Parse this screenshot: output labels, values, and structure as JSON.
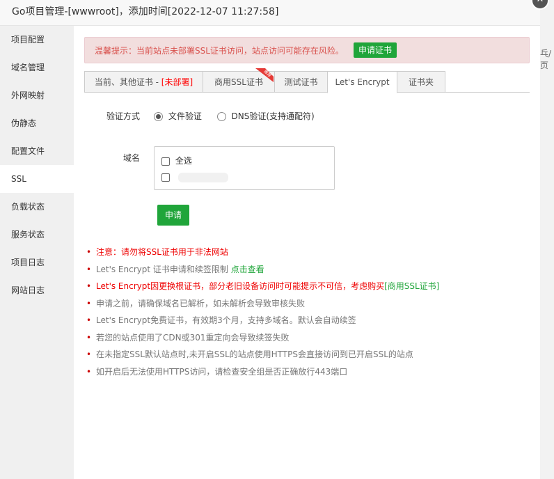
{
  "dialog": {
    "title": "Go项目管理-[wwwroot]，添加时间[2022-12-07 11:27:58]",
    "close_glyph": "✕",
    "right_fragment": "乓/页"
  },
  "sidebar": {
    "items": [
      {
        "label": "项目配置"
      },
      {
        "label": "域名管理"
      },
      {
        "label": "外网映射"
      },
      {
        "label": "伪静态"
      },
      {
        "label": "配置文件"
      },
      {
        "label": "SSL"
      },
      {
        "label": "负载状态"
      },
      {
        "label": "服务状态"
      },
      {
        "label": "项目日志"
      },
      {
        "label": "网站日志"
      }
    ],
    "active_index": 5
  },
  "alert": {
    "text": "温馨提示：当前站点未部署SSL证书访问，站点访问可能存在风险。",
    "button": "申请证书"
  },
  "tabs": {
    "items": [
      {
        "label": "当前、其他证书 - ",
        "extra": "[未部署]"
      },
      {
        "label": "商用SSL证书",
        "badge": "推荐"
      },
      {
        "label": "测试证书"
      },
      {
        "label": "Let's Encrypt"
      },
      {
        "label": "证书夹"
      }
    ],
    "active_index": 3
  },
  "form": {
    "verify_label": "验证方式",
    "verify_options": [
      {
        "label": "文件验证",
        "checked": true
      },
      {
        "label": "DNS验证(支持通配符)",
        "checked": false
      }
    ],
    "domain_label": "域名",
    "select_all_label": "全选",
    "submit_button": "申请"
  },
  "notes": [
    {
      "text": "注意：请勿将SSL证书用于非法网站",
      "style": "red"
    },
    {
      "text": "Let's Encrypt 证书申请和续签限制 ",
      "link": "点击查看",
      "style": "gray"
    },
    {
      "text": "Let's Encrypt因更换根证书，部分老旧设备访问时可能提示不可信，考虑购买",
      "link": "[商用SSL证书]",
      "style": "red"
    },
    {
      "text": "申请之前，请确保域名已解析，如未解析会导致审核失败",
      "style": "gray"
    },
    {
      "text": "Let's Encrypt免费证书，有效期3个月，支持多域名。默认会自动续签",
      "style": "gray"
    },
    {
      "text": "若您的站点使用了CDN或301重定向会导致续签失败",
      "style": "gray"
    },
    {
      "text": "在未指定SSL默认站点时,未开启SSL的站点使用HTTPS会直接访问到已开启SSL的站点",
      "style": "gray"
    },
    {
      "text": "如开启后无法使用HTTPS访问，请检查安全组是否正确放行443端口",
      "style": "gray"
    }
  ],
  "colors": {
    "accent_green": "#20a53a",
    "alert_bg": "#f2dede",
    "warning_red": "#e00000"
  }
}
